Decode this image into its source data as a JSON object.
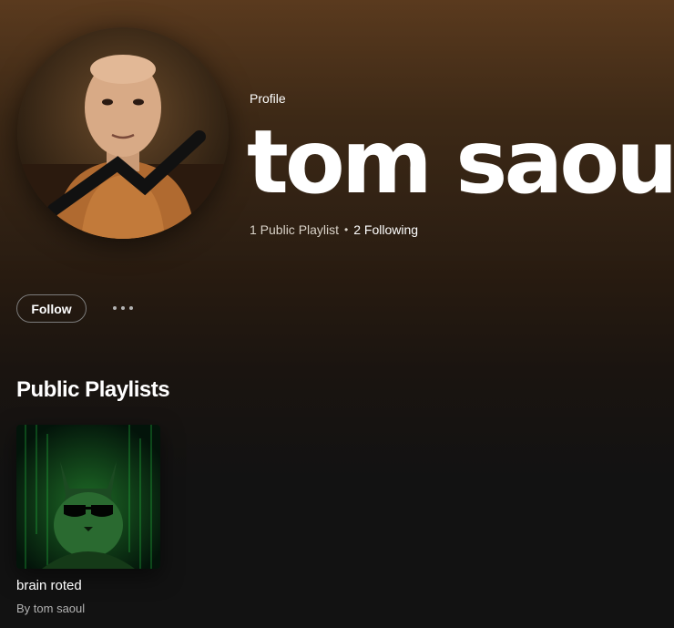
{
  "profile": {
    "kind_label": "Profile",
    "name": "tom saoul",
    "public_playlists": "1 Public Playlist",
    "separator": "•",
    "following": "2 Following"
  },
  "actions": {
    "follow_label": "Follow",
    "more_icon": "more-options-icon"
  },
  "sections": {
    "public_playlists_title": "Public Playlists"
  },
  "playlists": [
    {
      "title": "brain roted",
      "subtitle": "By tom saoul"
    }
  ],
  "colors": {
    "hero_top": "#5a3a1e",
    "hero_bottom": "#2a1d12",
    "background": "#121212",
    "secondary_text": "#b3b3b3"
  }
}
